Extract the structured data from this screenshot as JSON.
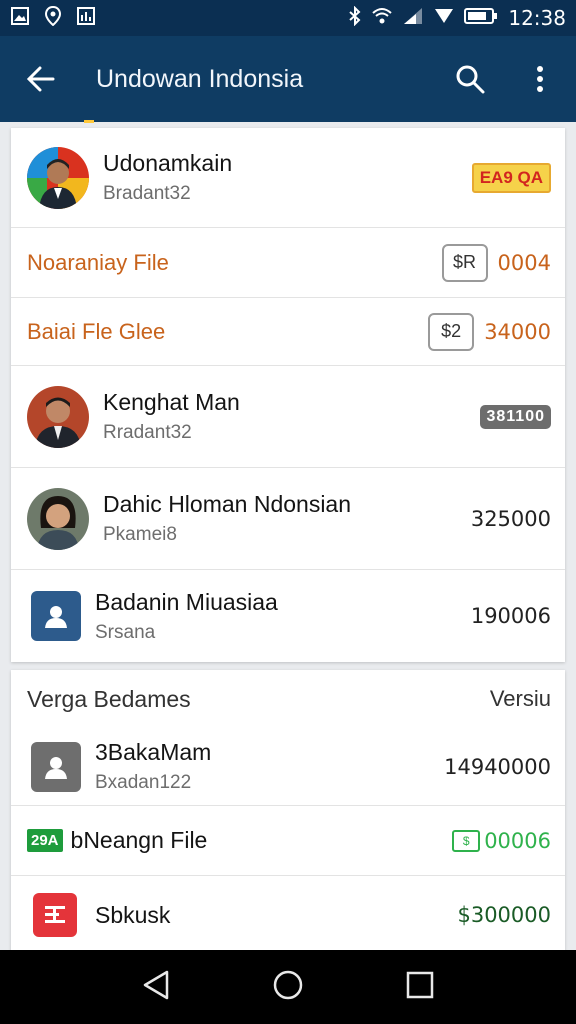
{
  "status": {
    "time": "12:38"
  },
  "appbar": {
    "title": "Undowan Indonsia"
  },
  "card1": {
    "profile": {
      "name": "Udonamkain",
      "sub": "Bradant32",
      "badge": "EA9 QA"
    },
    "file_row_1": {
      "label": "Noaraniay File",
      "chip": "$R",
      "value": "0004"
    },
    "file_row_2": {
      "label": "Baiai Fle Glee",
      "chip": "$2",
      "value": "34000"
    },
    "people": [
      {
        "name": "Kenghat Man",
        "sub": "Rradant32",
        "value": "381100"
      },
      {
        "name": "Dahic Hloman Ndonsian",
        "sub": "Pkamei8",
        "value": "325000"
      },
      {
        "name": "Badanin Miuasiaa",
        "sub": "Srsana",
        "value": "190006"
      }
    ]
  },
  "card2": {
    "header_left": "Verga Bedames",
    "header_right": "Versiu",
    "rows": [
      {
        "name": "3BakaMam",
        "sub": "Bxadan122",
        "value": "14940000"
      },
      {
        "badge": "29A",
        "name": "bNeangn File",
        "value": "00006"
      },
      {
        "name": "Sbkusk",
        "value": "$300000"
      }
    ]
  },
  "colors": {
    "appbar": "#0f3c63",
    "orange": "#c8631c",
    "green": "#2fb24c"
  }
}
